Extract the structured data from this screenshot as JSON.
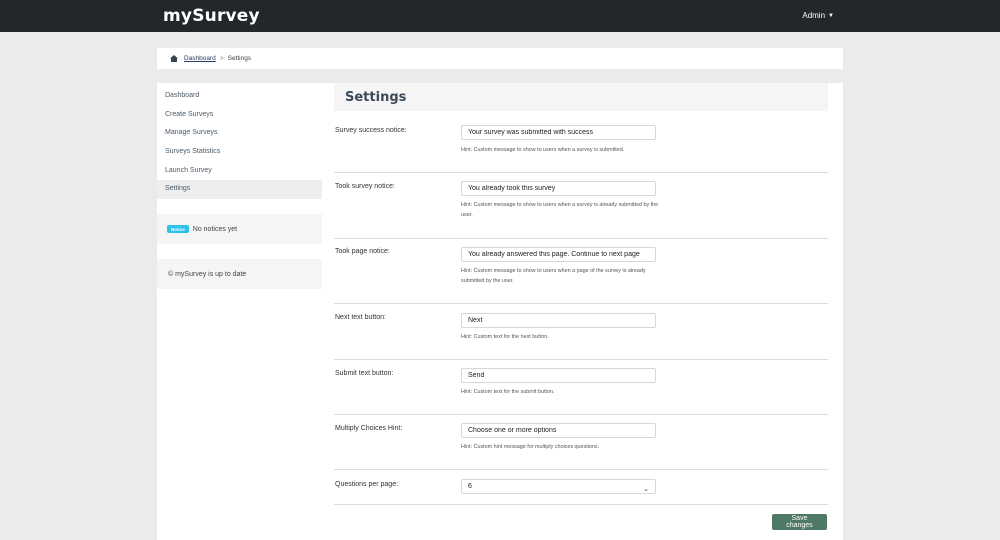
{
  "app": {
    "brand": "mySurvey",
    "user_menu_label": "Admin"
  },
  "breadcrumb": {
    "dashboard_link": "Dashboard",
    "separator": ">",
    "current": "Settings"
  },
  "sidebar": {
    "items": [
      {
        "label": "Dashboard"
      },
      {
        "label": "Create Surveys"
      },
      {
        "label": "Manage Surveys"
      },
      {
        "label": "Surveys Statistics"
      },
      {
        "label": "Launch Survey"
      },
      {
        "label": "Settings",
        "active": true
      }
    ],
    "notices_badge": "Notice",
    "notices_text": "No notices yet",
    "status_text": "© mySurvey is up to date"
  },
  "settings": {
    "title": "Settings",
    "fields": [
      {
        "label": "Survey success notice:",
        "value": "Your survey was submitted with success",
        "hint": "Hint: Custom message to show to users when a survey is submitted."
      },
      {
        "label": "Took survey notice:",
        "value": "You already took this survey",
        "hint": "Hint: Custom message to show to users when a survey is already submitted by the user."
      },
      {
        "label": "Took page notice:",
        "value": "You already answered this page. Continue to next page",
        "hint": "Hint: Custom message to show to users when a page of the survey is already submitted by the user."
      },
      {
        "label": "Next text button:",
        "value": "Next",
        "hint": "Hint: Custom text for the next button."
      },
      {
        "label": "Submit text button:",
        "value": "Send",
        "hint": "Hint: Custom text for the submit button."
      },
      {
        "label": "Multiply Choices Hint:",
        "value": "Choose one or more options",
        "hint": "Hint: Custom hint message for multiply choices questions."
      }
    ],
    "questions_per_page": {
      "label": "Questions per page:",
      "selected": "6"
    },
    "save_label": "Save changes"
  },
  "colors": {
    "topbar": "#23272b",
    "accent_button": "#4c7a66",
    "badge": "#2fc1e8",
    "title": "#3d4a5c"
  },
  "icons": {
    "home": "home-icon",
    "caret": "caret-down-icon",
    "select": "chevron-down-icon"
  }
}
